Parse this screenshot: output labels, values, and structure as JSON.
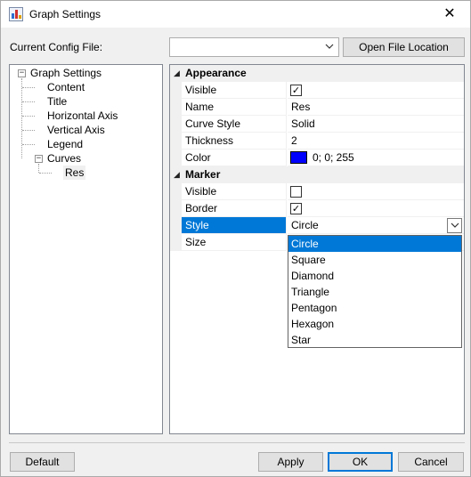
{
  "window": {
    "title": "Graph Settings",
    "close_glyph": "✕"
  },
  "config": {
    "label": "Current Config File:",
    "selected_value": "",
    "open_button_label": "Open File Location"
  },
  "tree": {
    "root": {
      "label": "Graph Settings",
      "expander": "−"
    },
    "children": [
      "Content",
      "Title",
      "Horizontal Axis",
      "Vertical Axis",
      "Legend"
    ],
    "curves": {
      "label": "Curves",
      "expander": "−",
      "children": [
        "Res"
      ]
    }
  },
  "grid": {
    "appearance": {
      "label": "Appearance",
      "props": {
        "visible": {
          "name": "Visible",
          "checked": true
        },
        "name": {
          "name": "Name",
          "value": "Res"
        },
        "curve_style": {
          "name": "Curve Style",
          "value": "Solid"
        },
        "thickness": {
          "name": "Thickness",
          "value": "2"
        },
        "color": {
          "name": "Color",
          "value": "0; 0; 255",
          "swatch": "#0000ff"
        }
      }
    },
    "marker": {
      "label": "Marker",
      "props": {
        "visible": {
          "name": "Visible",
          "checked": false
        },
        "border": {
          "name": "Border",
          "checked": true
        },
        "style": {
          "name": "Style",
          "value": "Circle"
        },
        "size": {
          "name": "Size",
          "value": ""
        }
      }
    }
  },
  "style_dropdown": {
    "options": [
      "Circle",
      "Square",
      "Diamond",
      "Triangle",
      "Pentagon",
      "Hexagon",
      "Star"
    ],
    "selected": "Circle"
  },
  "buttons": {
    "default": "Default",
    "apply": "Apply",
    "ok": "OK",
    "cancel": "Cancel"
  },
  "colors": {
    "accent": "#0078d7",
    "curve_color": "#0000ff"
  },
  "icons": {
    "collapse": "minus-box-icon",
    "category_toggle": "triangle-down-icon",
    "check": "checkmark-icon",
    "dropdown": "chevron-down-icon"
  }
}
